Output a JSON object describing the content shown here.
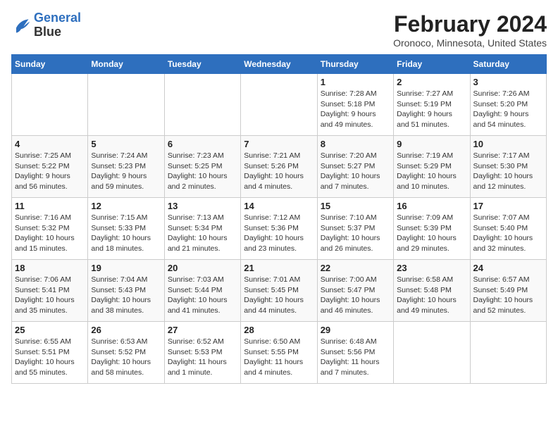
{
  "header": {
    "logo_line1": "General",
    "logo_line2": "Blue",
    "month": "February 2024",
    "location": "Oronoco, Minnesota, United States"
  },
  "weekdays": [
    "Sunday",
    "Monday",
    "Tuesday",
    "Wednesday",
    "Thursday",
    "Friday",
    "Saturday"
  ],
  "weeks": [
    [
      {
        "day": "",
        "info": ""
      },
      {
        "day": "",
        "info": ""
      },
      {
        "day": "",
        "info": ""
      },
      {
        "day": "",
        "info": ""
      },
      {
        "day": "1",
        "info": "Sunrise: 7:28 AM\nSunset: 5:18 PM\nDaylight: 9 hours\nand 49 minutes."
      },
      {
        "day": "2",
        "info": "Sunrise: 7:27 AM\nSunset: 5:19 PM\nDaylight: 9 hours\nand 51 minutes."
      },
      {
        "day": "3",
        "info": "Sunrise: 7:26 AM\nSunset: 5:20 PM\nDaylight: 9 hours\nand 54 minutes."
      }
    ],
    [
      {
        "day": "4",
        "info": "Sunrise: 7:25 AM\nSunset: 5:22 PM\nDaylight: 9 hours\nand 56 minutes."
      },
      {
        "day": "5",
        "info": "Sunrise: 7:24 AM\nSunset: 5:23 PM\nDaylight: 9 hours\nand 59 minutes."
      },
      {
        "day": "6",
        "info": "Sunrise: 7:23 AM\nSunset: 5:25 PM\nDaylight: 10 hours\nand 2 minutes."
      },
      {
        "day": "7",
        "info": "Sunrise: 7:21 AM\nSunset: 5:26 PM\nDaylight: 10 hours\nand 4 minutes."
      },
      {
        "day": "8",
        "info": "Sunrise: 7:20 AM\nSunset: 5:27 PM\nDaylight: 10 hours\nand 7 minutes."
      },
      {
        "day": "9",
        "info": "Sunrise: 7:19 AM\nSunset: 5:29 PM\nDaylight: 10 hours\nand 10 minutes."
      },
      {
        "day": "10",
        "info": "Sunrise: 7:17 AM\nSunset: 5:30 PM\nDaylight: 10 hours\nand 12 minutes."
      }
    ],
    [
      {
        "day": "11",
        "info": "Sunrise: 7:16 AM\nSunset: 5:32 PM\nDaylight: 10 hours\nand 15 minutes."
      },
      {
        "day": "12",
        "info": "Sunrise: 7:15 AM\nSunset: 5:33 PM\nDaylight: 10 hours\nand 18 minutes."
      },
      {
        "day": "13",
        "info": "Sunrise: 7:13 AM\nSunset: 5:34 PM\nDaylight: 10 hours\nand 21 minutes."
      },
      {
        "day": "14",
        "info": "Sunrise: 7:12 AM\nSunset: 5:36 PM\nDaylight: 10 hours\nand 23 minutes."
      },
      {
        "day": "15",
        "info": "Sunrise: 7:10 AM\nSunset: 5:37 PM\nDaylight: 10 hours\nand 26 minutes."
      },
      {
        "day": "16",
        "info": "Sunrise: 7:09 AM\nSunset: 5:39 PM\nDaylight: 10 hours\nand 29 minutes."
      },
      {
        "day": "17",
        "info": "Sunrise: 7:07 AM\nSunset: 5:40 PM\nDaylight: 10 hours\nand 32 minutes."
      }
    ],
    [
      {
        "day": "18",
        "info": "Sunrise: 7:06 AM\nSunset: 5:41 PM\nDaylight: 10 hours\nand 35 minutes."
      },
      {
        "day": "19",
        "info": "Sunrise: 7:04 AM\nSunset: 5:43 PM\nDaylight: 10 hours\nand 38 minutes."
      },
      {
        "day": "20",
        "info": "Sunrise: 7:03 AM\nSunset: 5:44 PM\nDaylight: 10 hours\nand 41 minutes."
      },
      {
        "day": "21",
        "info": "Sunrise: 7:01 AM\nSunset: 5:45 PM\nDaylight: 10 hours\nand 44 minutes."
      },
      {
        "day": "22",
        "info": "Sunrise: 7:00 AM\nSunset: 5:47 PM\nDaylight: 10 hours\nand 46 minutes."
      },
      {
        "day": "23",
        "info": "Sunrise: 6:58 AM\nSunset: 5:48 PM\nDaylight: 10 hours\nand 49 minutes."
      },
      {
        "day": "24",
        "info": "Sunrise: 6:57 AM\nSunset: 5:49 PM\nDaylight: 10 hours\nand 52 minutes."
      }
    ],
    [
      {
        "day": "25",
        "info": "Sunrise: 6:55 AM\nSunset: 5:51 PM\nDaylight: 10 hours\nand 55 minutes."
      },
      {
        "day": "26",
        "info": "Sunrise: 6:53 AM\nSunset: 5:52 PM\nDaylight: 10 hours\nand 58 minutes."
      },
      {
        "day": "27",
        "info": "Sunrise: 6:52 AM\nSunset: 5:53 PM\nDaylight: 11 hours\nand 1 minute."
      },
      {
        "day": "28",
        "info": "Sunrise: 6:50 AM\nSunset: 5:55 PM\nDaylight: 11 hours\nand 4 minutes."
      },
      {
        "day": "29",
        "info": "Sunrise: 6:48 AM\nSunset: 5:56 PM\nDaylight: 11 hours\nand 7 minutes."
      },
      {
        "day": "",
        "info": ""
      },
      {
        "day": "",
        "info": ""
      }
    ]
  ]
}
